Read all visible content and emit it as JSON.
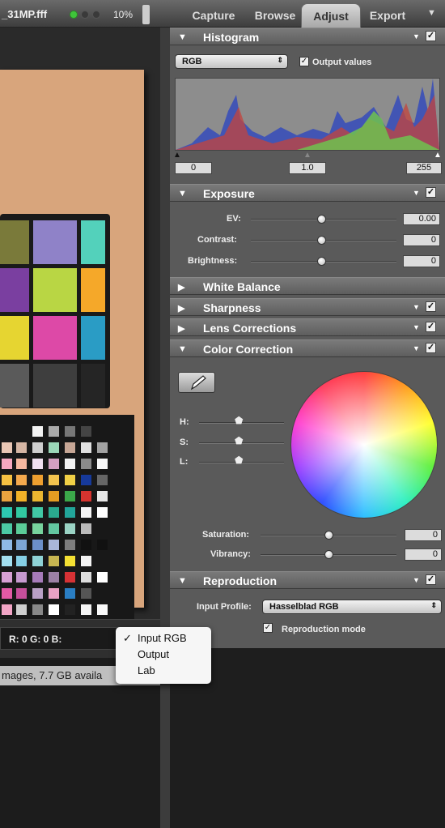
{
  "topbar": {
    "filename": "_31MP.fff",
    "zoom": "10%",
    "tabs": [
      "Capture",
      "Browse",
      "Adjust",
      "Export"
    ],
    "active_tab": "Adjust"
  },
  "viewer": {
    "rgb_readout": "R:   0  G:   0  B:",
    "status_text": "mages, 7.7 GB availa"
  },
  "popup": {
    "items": [
      "Input RGB",
      "Output",
      "Lab"
    ],
    "checked": "Input RGB",
    "check": "✓"
  },
  "histogram": {
    "title": "Histogram",
    "channel": "RGB",
    "output_values_label": "Output values",
    "black": "0",
    "gamma": "1.0",
    "white": "255"
  },
  "exposure": {
    "title": "Exposure",
    "ev_label": "EV:",
    "ev": "0.00",
    "contrast_label": "Contrast:",
    "contrast": "0",
    "brightness_label": "Brightness:",
    "brightness": "0"
  },
  "sections": {
    "white_balance": "White Balance",
    "sharpness": "Sharpness",
    "lens": "Lens Corrections"
  },
  "color_correction": {
    "title": "Color Correction",
    "h_label": "H:",
    "s_label": "S:",
    "l_label": "L:",
    "saturation_label": "Saturation:",
    "saturation": "0",
    "vibrancy_label": "Vibrancy:",
    "vibrancy": "0"
  },
  "reproduction": {
    "title": "Reproduction",
    "input_profile_label": "Input Profile:",
    "input_profile": "Hasselblad RGB",
    "mode_label": "Reproduction mode"
  },
  "icons": {
    "expanded": "triangle-down",
    "collapsed": "triangle-right",
    "check": "✓"
  },
  "colors": {
    "panel": "#5a5a5a",
    "accent_green": "#3fc43a"
  }
}
